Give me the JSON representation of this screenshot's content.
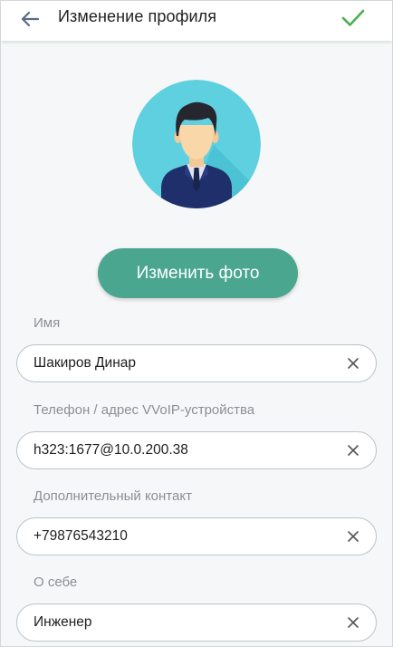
{
  "appbar": {
    "title": "Изменение профиля",
    "back_icon": "arrow-left-icon",
    "confirm_icon": "checkmark-icon"
  },
  "avatar": {
    "icon": "user-avatar-icon"
  },
  "change_photo": {
    "label": "Изменить фото"
  },
  "fields": [
    {
      "label": "Имя",
      "value": "Шакиров Динар"
    },
    {
      "label": "Телефон / адрес VVoIP-устройства",
      "value": "h323:1677@10.0.200.38"
    },
    {
      "label": "Дополнительный контакт",
      "value": "+79876543210"
    },
    {
      "label": "О себе",
      "value": "Инженер"
    }
  ],
  "colors": {
    "accent": "#4aa68f",
    "confirm": "#4caf50",
    "avatar_bg": "#5fd0e0",
    "back_arrow": "#5a6b88"
  }
}
